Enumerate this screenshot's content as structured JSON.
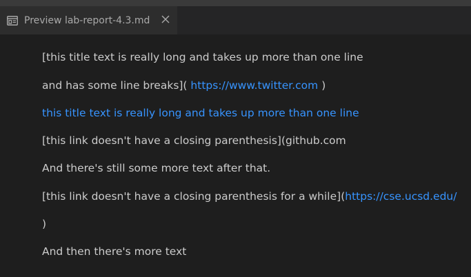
{
  "tab": {
    "icon": "preview-icon",
    "title": "Preview lab-report-4.3.md",
    "close_icon": "close-icon"
  },
  "preview": {
    "line1": "[this title text is really long and takes up more than one line",
    "line2_text": "and has some line breaks](",
    "line2_link": "https://www.twitter.com",
    "line2_tail": ")",
    "line3_link": "this title text is really long and takes up more than one line",
    "line4": "[this link doesn't have a closing parenthesis](github.com",
    "line5": "And there's still some more text after that.",
    "line6_text": "[this link doesn't have a closing parenthesis for a while](",
    "line6_link": "https://cse.ucsd.edu/",
    "line7": ")",
    "line8": "And then there's more text"
  },
  "colors": {
    "background": "#1e1e1e",
    "text": "#cccccc",
    "link": "#3794ff",
    "tab_active": "#2d2d2d",
    "tab_bar": "#252526"
  }
}
